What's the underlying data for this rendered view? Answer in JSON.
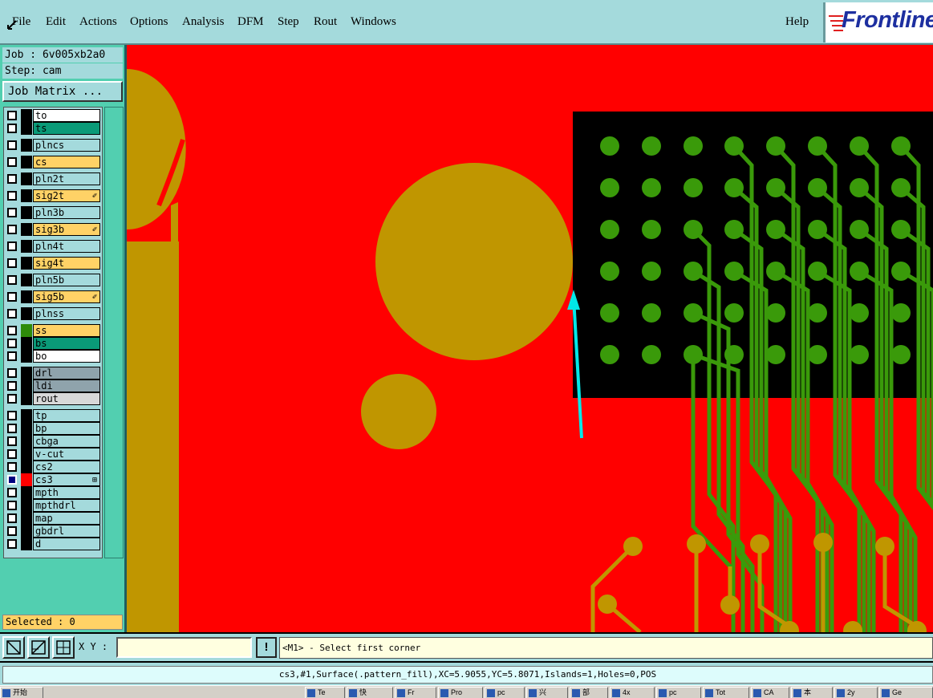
{
  "menubar": {
    "items": [
      "File",
      "Edit",
      "Actions",
      "Options",
      "Analysis",
      "DFM",
      "Step",
      "Rout",
      "Windows"
    ],
    "help": "Help",
    "logo": "Frontline"
  },
  "side": {
    "job": "Job : 6v005xb2a0",
    "step": "Step: cam",
    "job_matrix": "Job Matrix ...",
    "selected": "Selected : 0"
  },
  "layers": [
    {
      "name": "to",
      "color": "#ffffff",
      "swatch": "#000000"
    },
    {
      "name": "ts",
      "color": "#0a9a78",
      "swatch": "#000000"
    },
    {
      "name": "plncs",
      "color": "#a4dadc",
      "swatch": "#000000"
    },
    {
      "name": "cs",
      "color": "#ffd266",
      "swatch": "#000000"
    },
    {
      "name": "pln2t",
      "color": "#a4dadc",
      "swatch": "#000000"
    },
    {
      "name": "sig2t",
      "color": "#ffd266",
      "swatch": "#000000",
      "mark": "✐"
    },
    {
      "name": "pln3b",
      "color": "#a4dadc",
      "swatch": "#000000"
    },
    {
      "name": "sig3b",
      "color": "#ffd266",
      "swatch": "#000000",
      "mark": "✐"
    },
    {
      "name": "pln4t",
      "color": "#a4dadc",
      "swatch": "#000000"
    },
    {
      "name": "sig4t",
      "color": "#ffd266",
      "swatch": "#000000"
    },
    {
      "name": "pln5b",
      "color": "#a4dadc",
      "swatch": "#000000"
    },
    {
      "name": "sig5b",
      "color": "#ffd266",
      "swatch": "#000000",
      "mark": "✐"
    },
    {
      "name": "plnss",
      "color": "#a4dadc",
      "swatch": "#000000"
    },
    {
      "name": "ss",
      "color": "#ffd266",
      "swatch": "#2e8b0a"
    },
    {
      "name": "bs",
      "color": "#0a9a78",
      "swatch": "#000000"
    },
    {
      "name": "bo",
      "color": "#ffffff",
      "swatch": "#000000"
    },
    {
      "name": "drl",
      "color": "#8fa3ac",
      "swatch": "#000000"
    },
    {
      "name": "ldi",
      "color": "#8fa3ac",
      "swatch": "#000000"
    },
    {
      "name": "rout",
      "color": "#d8d8d8",
      "swatch": "#000000"
    },
    {
      "name": "tp",
      "color": "#a4dadc",
      "swatch": "#000000"
    },
    {
      "name": "bp",
      "color": "#a4dadc",
      "swatch": "#000000"
    },
    {
      "name": "cbga",
      "color": "#a4dadc",
      "swatch": "#000000"
    },
    {
      "name": "v-cut",
      "color": "#a4dadc",
      "swatch": "#000000"
    },
    {
      "name": "cs2",
      "color": "#a4dadc",
      "swatch": "#000000"
    },
    {
      "name": "cs3",
      "color": "#a4dadc",
      "swatch": "#ff0000",
      "active": true,
      "mark": "⊞"
    },
    {
      "name": "mpth",
      "color": "#a4dadc",
      "swatch": "#000000"
    },
    {
      "name": "mpthdrl",
      "color": "#a4dadc",
      "swatch": "#000000"
    },
    {
      "name": "map",
      "color": "#a4dadc",
      "swatch": "#000000"
    },
    {
      "name": "gbdrl",
      "color": "#a4dadc",
      "swatch": "#000000"
    },
    {
      "name": "d",
      "color": "#a4dadc",
      "swatch": "#000000"
    }
  ],
  "cmdbar": {
    "xy_label": "X Y :",
    "xy_value": "",
    "excl": "!",
    "prompt": "<M1> - Select first corner"
  },
  "status": "cs3,#1,Surface(.pattern_fill),XC=5.9055,YC=5.8071,Islands=1,Holes=0,POS",
  "taskbar": [
    {
      "label": "开始"
    },
    {
      "label": "Te"
    },
    {
      "label": "快"
    },
    {
      "label": "Fr"
    },
    {
      "label": "Pro"
    },
    {
      "label": "pc"
    },
    {
      "label": "兴"
    },
    {
      "label": "部"
    },
    {
      "label": "4x"
    },
    {
      "label": "pc"
    },
    {
      "label": "Tot"
    },
    {
      "label": "CA"
    },
    {
      "label": "本"
    },
    {
      "label": "2y"
    },
    {
      "label": "Ge"
    }
  ],
  "colors": {
    "surface_red": "#ff0000",
    "copper": "#c09600",
    "pad_green": "#3a9a0a",
    "black_area": "#000000",
    "cursor_cyan": "#00e8e8"
  }
}
